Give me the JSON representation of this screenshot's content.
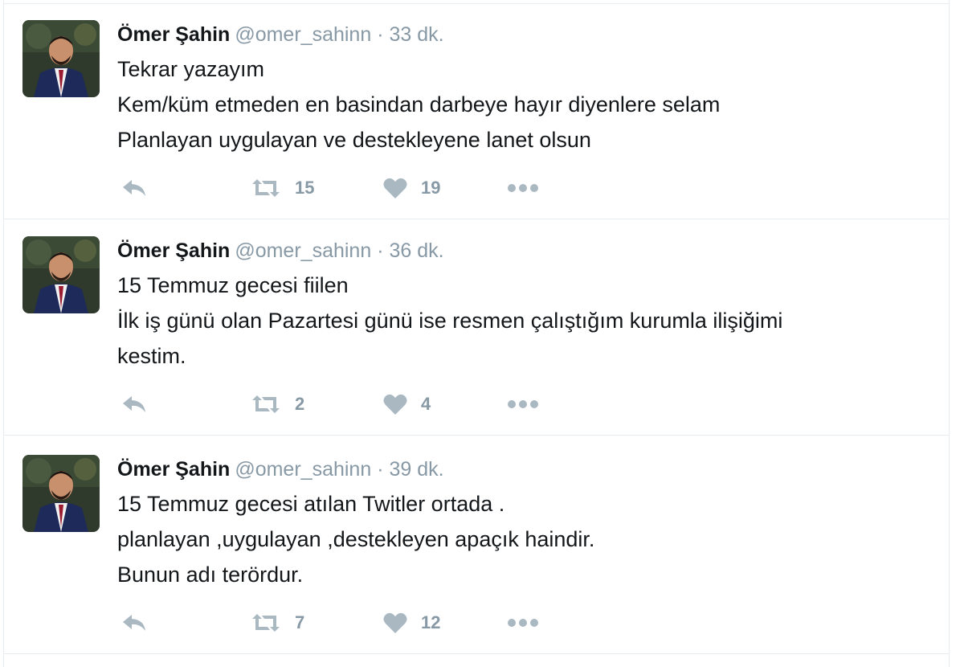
{
  "tweets": [
    {
      "name": "Ömer Şahin",
      "handle": "@omer_sahinn",
      "sep": "·",
      "time": "33 dk.",
      "lines": [
        "Tekrar yazayım",
        "Kem/küm etmeden en basindan darbeye hayır diyenlere selam",
        "Planlayan uygulayan ve destekleyene lanet olsun"
      ],
      "retweets": "15",
      "likes": "19"
    },
    {
      "name": "Ömer Şahin",
      "handle": "@omer_sahinn",
      "sep": "·",
      "time": "36 dk.",
      "lines": [
        "15 Temmuz gecesi fiilen",
        "İlk iş günü olan Pazartesi günü ise resmen çalıştığım kurumla ilişiğimi",
        "kestim."
      ],
      "retweets": "2",
      "likes": "4"
    },
    {
      "name": "Ömer Şahin",
      "handle": "@omer_sahinn",
      "sep": "·",
      "time": "39 dk.",
      "lines": [
        "15 Temmuz gecesi atılan Twitler ortada .",
        "planlayan ,uygulayan ,destekleyen apaçık haindir.",
        "Bunun adı terördur."
      ],
      "retweets": "7",
      "likes": "12"
    }
  ],
  "icons": {
    "reply": "reply-icon",
    "retweet": "retweet-icon",
    "like": "heart-icon",
    "more": "more-dots-icon"
  },
  "colors": {
    "muted": "#8899a6",
    "text": "#14171a",
    "icon": "#aab8c2",
    "border": "#e6ecf0"
  }
}
